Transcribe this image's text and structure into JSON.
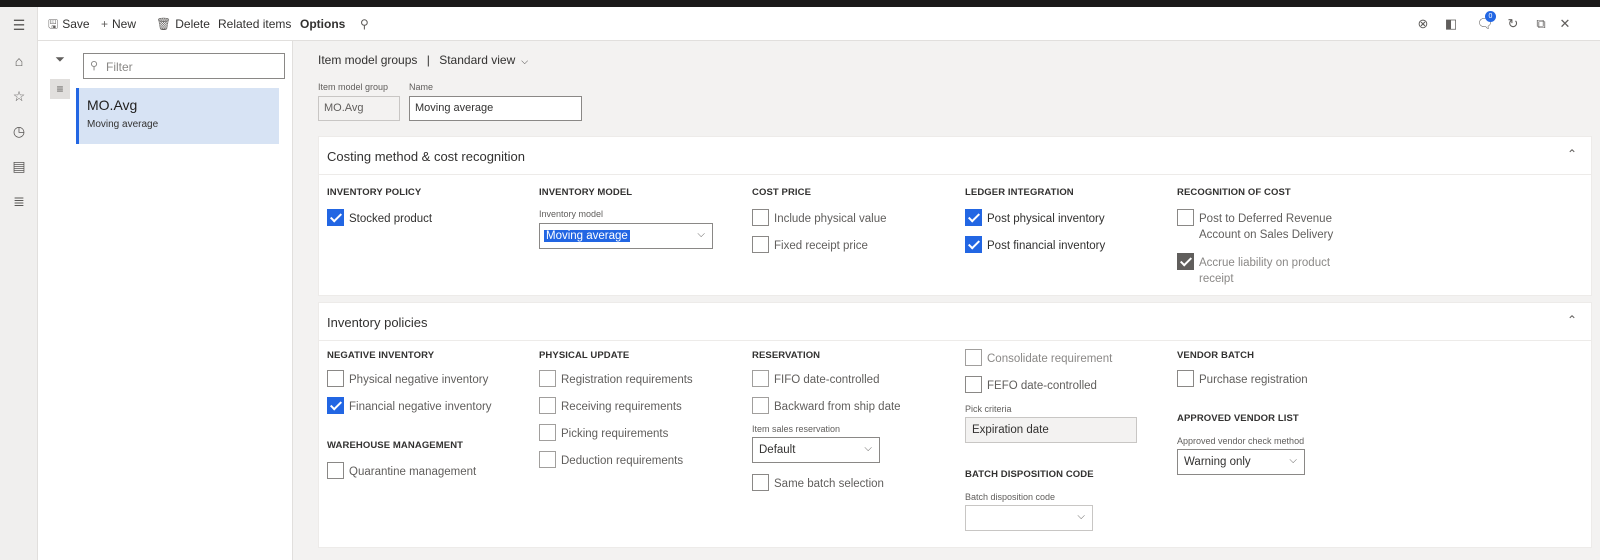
{
  "actionbar": {
    "save": "Save",
    "new": "New",
    "delete": "Delete",
    "related": "Related items",
    "options": "Options"
  },
  "icons": {
    "hamburger": "hamburger-icon",
    "home": "home-icon",
    "star": "star-icon",
    "clock": "clock-icon",
    "workspace": "workspace-icon",
    "list": "list-icon"
  },
  "notifications": {
    "count": "0"
  },
  "list_pane": {
    "filter_placeholder": "Filter",
    "items": [
      {
        "id": "MO.Avg",
        "name": "Moving average"
      }
    ]
  },
  "breadcrumb": {
    "page": "Item model groups",
    "separator": "|",
    "view": "Standard view"
  },
  "header": {
    "group_label": "Item model group",
    "group_value": "MO.Avg",
    "name_label": "Name",
    "name_value": "Moving average"
  },
  "costing": {
    "title": "Costing method & cost recognition",
    "inventory_policy": {
      "heading": "INVENTORY POLICY",
      "stocked_product": "Stocked product"
    },
    "inventory_model": {
      "heading": "INVENTORY MODEL",
      "field_label": "Inventory model",
      "value": "Moving average"
    },
    "cost_price": {
      "heading": "COST PRICE",
      "include_physical": "Include physical value",
      "fixed_receipt": "Fixed receipt price"
    },
    "ledger": {
      "heading": "LEDGER INTEGRATION",
      "post_physical": "Post physical inventory",
      "post_financial": "Post financial inventory"
    },
    "recognition": {
      "heading": "RECOGNITION OF COST",
      "deferred_line1": "Post to Deferred Revenue",
      "deferred_line2": "Account on Sales Delivery",
      "accrue_line1": "Accrue liability on product",
      "accrue_line2": "receipt"
    }
  },
  "policies": {
    "title": "Inventory policies",
    "negative": {
      "heading": "NEGATIVE INVENTORY",
      "physical": "Physical negative inventory",
      "financial": "Financial negative inventory"
    },
    "warehouse": {
      "heading": "WAREHOUSE MANAGEMENT",
      "quarantine": "Quarantine management"
    },
    "physical_update": {
      "heading": "PHYSICAL UPDATE",
      "registration": "Registration requirements",
      "receiving": "Receiving requirements",
      "picking": "Picking requirements",
      "deduction": "Deduction requirements"
    },
    "reservation": {
      "heading": "RESERVATION",
      "fifo": "FIFO date-controlled",
      "backward": "Backward from ship date",
      "sales_res_label": "Item sales reservation",
      "sales_res_value": "Default",
      "same_batch": "Same batch selection"
    },
    "misc": {
      "consolidate": "Consolidate requirement",
      "fefo": "FEFO date-controlled",
      "pick_label": "Pick criteria",
      "pick_value": "Expiration date",
      "batch_heading": "BATCH DISPOSITION CODE",
      "batch_label": "Batch disposition code"
    },
    "vendor_batch": {
      "heading": "VENDOR BATCH",
      "purchase": "Purchase registration"
    },
    "approved_vendor": {
      "heading": "APPROVED VENDOR LIST",
      "field_label": "Approved vendor check method",
      "value": "Warning only"
    }
  }
}
